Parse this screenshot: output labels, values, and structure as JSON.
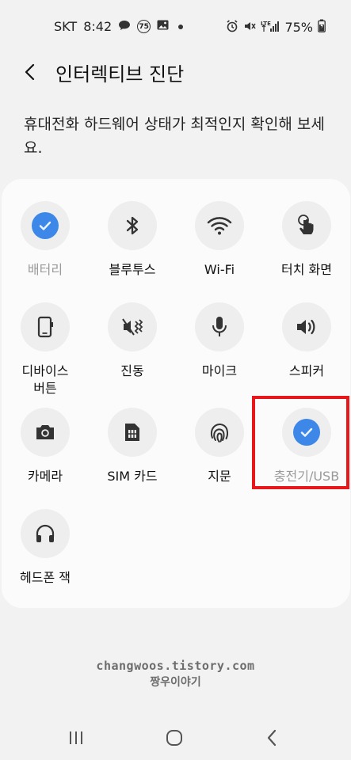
{
  "status": {
    "carrier": "SKT",
    "time": "8:42",
    "badge": "75",
    "battery": "75%"
  },
  "header": {
    "title": "인터렉티브 진단"
  },
  "description": "휴대전화 하드웨어 상태가 최적인지 확인해 보세요.",
  "items": [
    {
      "label": "배터리",
      "icon": "check-icon",
      "done": true
    },
    {
      "label": "블루투스",
      "icon": "bluetooth-icon"
    },
    {
      "label": "Wi-Fi",
      "icon": "wifi-icon"
    },
    {
      "label": "터치 화면",
      "icon": "touch-icon"
    },
    {
      "label": "디바이스\n버튼",
      "icon": "device-button-icon"
    },
    {
      "label": "진동",
      "icon": "vibration-icon"
    },
    {
      "label": "마이크",
      "icon": "microphone-icon"
    },
    {
      "label": "스피커",
      "icon": "speaker-icon"
    },
    {
      "label": "카메라",
      "icon": "camera-icon"
    },
    {
      "label": "SIM 카드",
      "icon": "sim-card-icon"
    },
    {
      "label": "지문",
      "icon": "fingerprint-icon"
    },
    {
      "label": "충전기/USB",
      "icon": "check-icon",
      "done": true
    },
    {
      "label": "헤드폰 잭",
      "icon": "headphone-icon"
    }
  ],
  "watermark": {
    "line1": "changwoos.tistory.com",
    "line2": "짱우이야기"
  },
  "colors": {
    "accent": "#3c87e8",
    "highlight": "#e8171b"
  }
}
